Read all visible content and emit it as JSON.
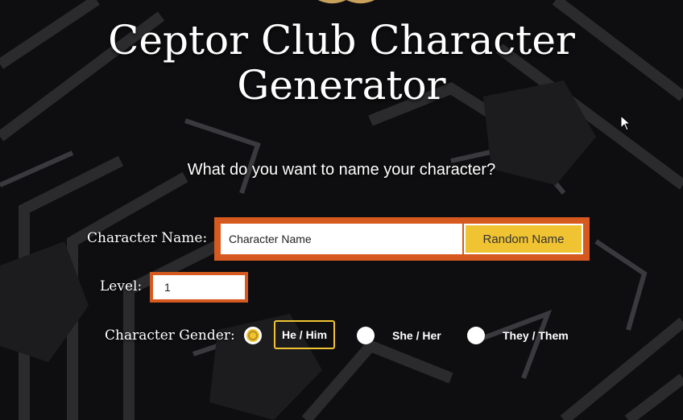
{
  "header": {
    "title_line1": "Ceptor Club Character",
    "title_line2": "Generator"
  },
  "prompt": "What do you want to name your character?",
  "form": {
    "name_label": "Character Name:",
    "name_placeholder": "Character Name",
    "random_button": "Random Name",
    "level_label": "Level:",
    "level_value": "1",
    "gender_label": "Character Gender:",
    "gender_options": [
      {
        "label": "He / Him",
        "selected": true
      },
      {
        "label": "She / Her",
        "selected": false
      },
      {
        "label": "They / Them",
        "selected": false
      }
    ]
  },
  "colors": {
    "accent": "#f0c332",
    "border": "#d65a1f",
    "background": "#0e0e10"
  }
}
